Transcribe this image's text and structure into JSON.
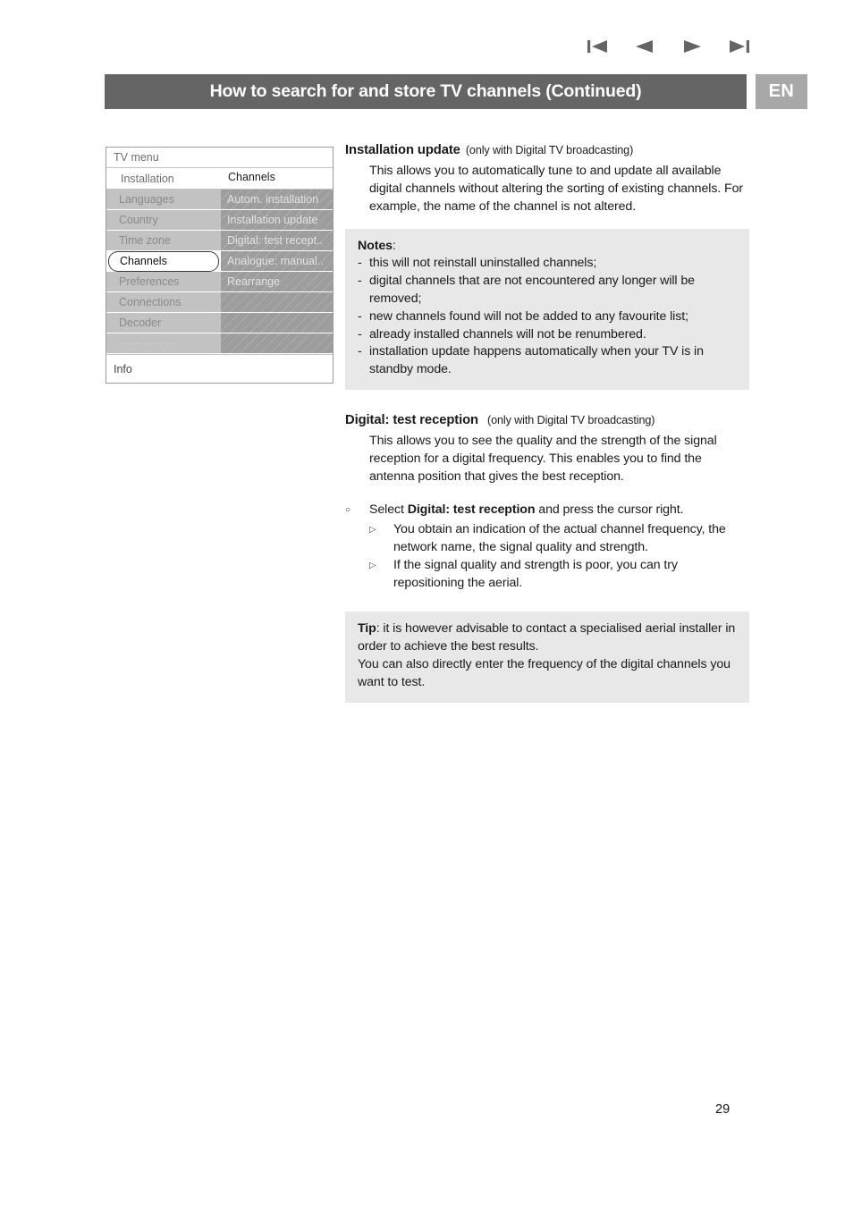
{
  "nav": {
    "icons": [
      {
        "name": "skip-to-first-icon",
        "label": "First page"
      },
      {
        "name": "previous-page-icon",
        "label": "Previous page"
      },
      {
        "name": "next-page-icon",
        "label": "Next page"
      },
      {
        "name": "skip-to-last-icon",
        "label": "Last page"
      }
    ]
  },
  "header": {
    "title": "How to search for and store TV channels  (Continued)",
    "language_badge": "EN",
    "bar_color": "#656565",
    "badge_color": "#a8a8a8"
  },
  "tv_menu": {
    "title": "TV menu",
    "submenu_left": "Installation",
    "submenu_right": "Channels",
    "left_items": [
      {
        "label": "Languages",
        "selected": false
      },
      {
        "label": "Country",
        "selected": false
      },
      {
        "label": "Time zone",
        "selected": false
      },
      {
        "label": "Channels",
        "selected": true
      },
      {
        "label": "Preferences",
        "selected": false
      },
      {
        "label": "Connections",
        "selected": false
      },
      {
        "label": "Decoder",
        "selected": false
      },
      {
        "label": "··············",
        "selected": false
      }
    ],
    "right_items": [
      "Autom. installation",
      "Installation update",
      "Digital: test recept..",
      "Analogue: manual..",
      "Rearrange",
      "",
      "",
      ""
    ],
    "info_label": "Info"
  },
  "content": {
    "section1": {
      "heading": "Installation update",
      "heading_note": "(only with Digital TV broadcasting)",
      "paragraph": "This allows you to automatically tune to and update all available digital channels without altering the sorting of existing channels. For example, the name of the channel is not altered.",
      "notes_title": "Notes",
      "notes_colon": ":",
      "notes": [
        "this will not reinstall uninstalled channels;",
        "digital channels that are not encountered any longer will be removed;",
        "new channels found will not be added to any favourite list;",
        "already installed channels will not be renumbered.",
        "installation update happens automatically when your TV is in standby mode."
      ]
    },
    "section2": {
      "heading": "Digital: test reception",
      "heading_note": "(only with Digital TV broadcasting)",
      "paragraph": "This allows you to see the quality and the strength of the signal reception for a digital frequency. This enables you to find the antenna position that gives the best reception.",
      "bullet_main_pre": "Select ",
      "bullet_main_bold": "Digital: test reception",
      "bullet_main_post": " and press the cursor right.",
      "sub_bullets": [
        "You obtain an indication of the actual channel frequency, the network name, the signal quality and strength.",
        "If the signal quality and strength is poor, you can try repositioning the aerial."
      ],
      "tip_title": "Tip",
      "tip_colon": ":",
      "tip_line1": " it is however advisable to contact a specialised aerial installer in order to achieve the best results.",
      "tip_line2": "You can also directly enter the frequency of the digital channels you want to test."
    }
  },
  "footer": {
    "page_number": "29"
  }
}
